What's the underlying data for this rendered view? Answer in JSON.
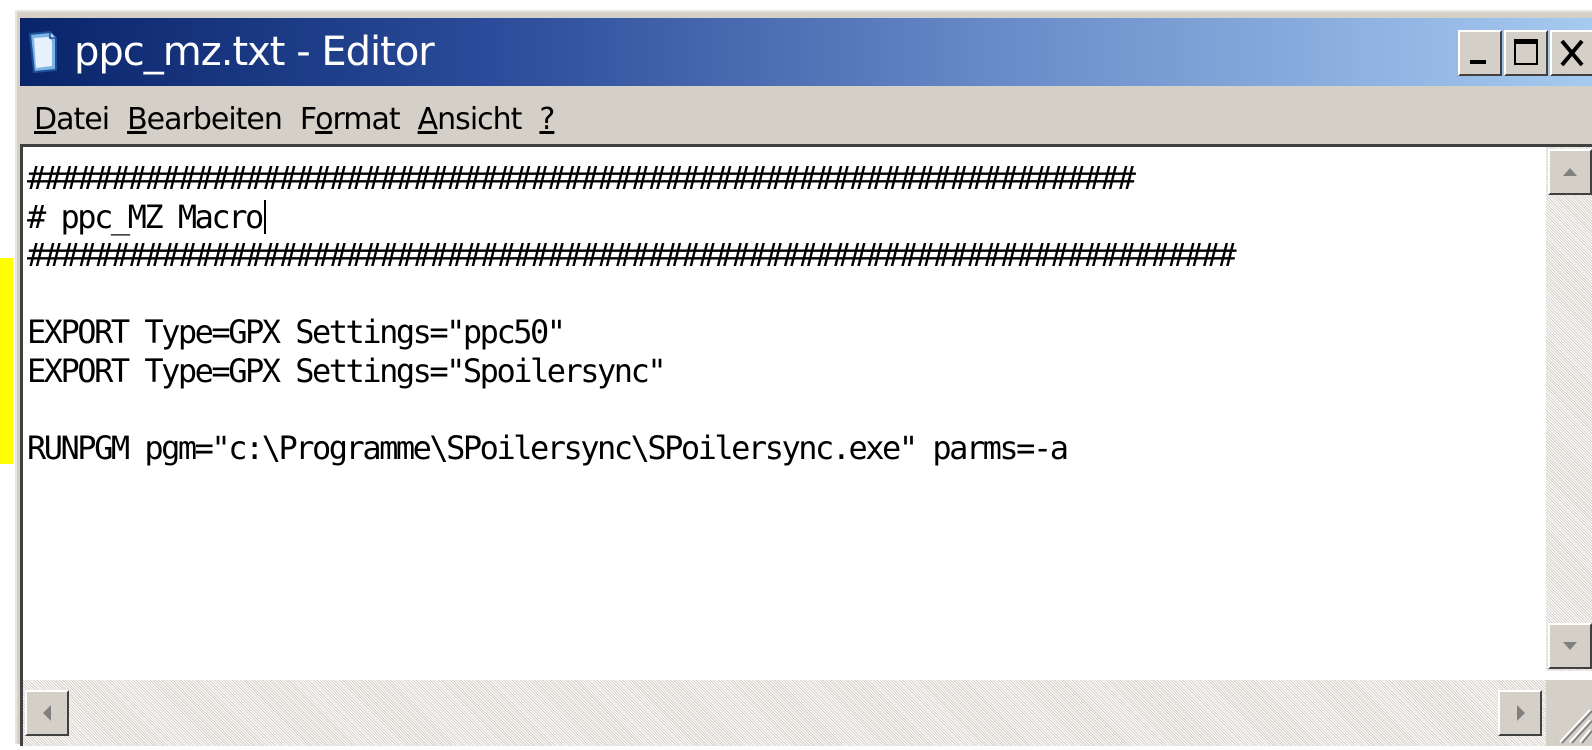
{
  "window": {
    "title": "ppc_mz.txt - Editor",
    "icon": "notepad-icon",
    "controls": {
      "minimize_icon": "minimize-icon",
      "maximize_icon": "maximize-icon",
      "close_icon": "close-icon"
    }
  },
  "menu": {
    "items": [
      {
        "accel": "D",
        "rest": "atei"
      },
      {
        "accel": "B",
        "rest": "earbeiten"
      },
      {
        "pre": "F",
        "accel": "o",
        "rest": "rmat"
      },
      {
        "accel": "A",
        "rest": "nsicht"
      },
      {
        "accel": "?",
        "rest": ""
      }
    ]
  },
  "editor": {
    "lines": [
      "##################################################################",
      "# ppc_MZ Macro",
      "########################################################################",
      "",
      "EXPORT Type=GPX Settings=\"ppc50\"",
      "EXPORT Type=GPX Settings=\"Spoilersync\"",
      "",
      "RUNPGM pgm=\"c:\\Programme\\SPoilersync\\SPoilersync.exe\" parms=-a",
      "",
      "",
      "",
      ""
    ],
    "caret_line": 1
  },
  "colors": {
    "titlebar_start": "#0a246a",
    "titlebar_end": "#a6caf0",
    "chrome": "#d4d0c8",
    "highlight_marker": "#ffff00"
  }
}
